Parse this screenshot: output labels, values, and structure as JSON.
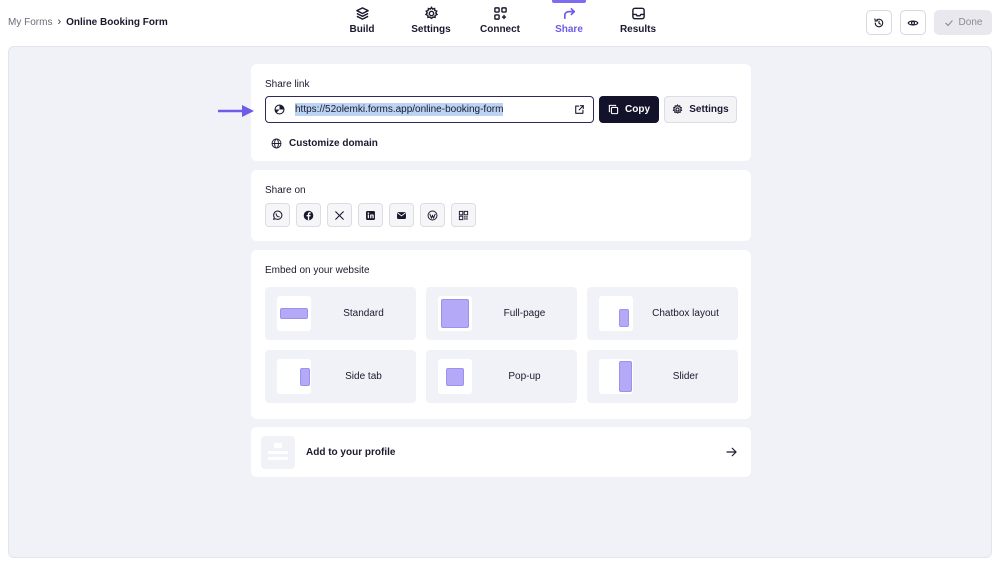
{
  "breadcrumb": {
    "parent": "My Forms",
    "separator": "›",
    "current": "Online Booking Form"
  },
  "nav": [
    {
      "label": "Build",
      "icon": "layers-icon"
    },
    {
      "label": "Settings",
      "icon": "gear-icon"
    },
    {
      "label": "Connect",
      "icon": "apps-plus-icon"
    },
    {
      "label": "Share",
      "icon": "share-arrow-icon",
      "active": true
    },
    {
      "label": "Results",
      "icon": "inbox-icon"
    }
  ],
  "toolbar": {
    "history_icon": "history-icon",
    "preview_icon": "eye-icon",
    "done_label": "Done"
  },
  "share_link": {
    "title": "Share link",
    "url": "https://52olemki.forms.app/online-booking-form",
    "copy_label": "Copy",
    "settings_label": "Settings",
    "customize_label": "Customize domain"
  },
  "share_on": {
    "title": "Share on",
    "icons": [
      "whatsapp-icon",
      "facebook-icon",
      "x-icon",
      "linkedin-icon",
      "email-icon",
      "wordpress-icon",
      "qr-code-icon"
    ]
  },
  "embed": {
    "title": "Embed on your website",
    "options": [
      {
        "label": "Standard"
      },
      {
        "label": "Full-page"
      },
      {
        "label": "Chatbox layout"
      },
      {
        "label": "Side tab"
      },
      {
        "label": "Pop-up"
      },
      {
        "label": "Slider"
      }
    ]
  },
  "profile": {
    "label": "Add to your profile"
  },
  "colors": {
    "accent": "#6c5ce7",
    "dark": "#12132b",
    "background": "#f1f2f7"
  }
}
